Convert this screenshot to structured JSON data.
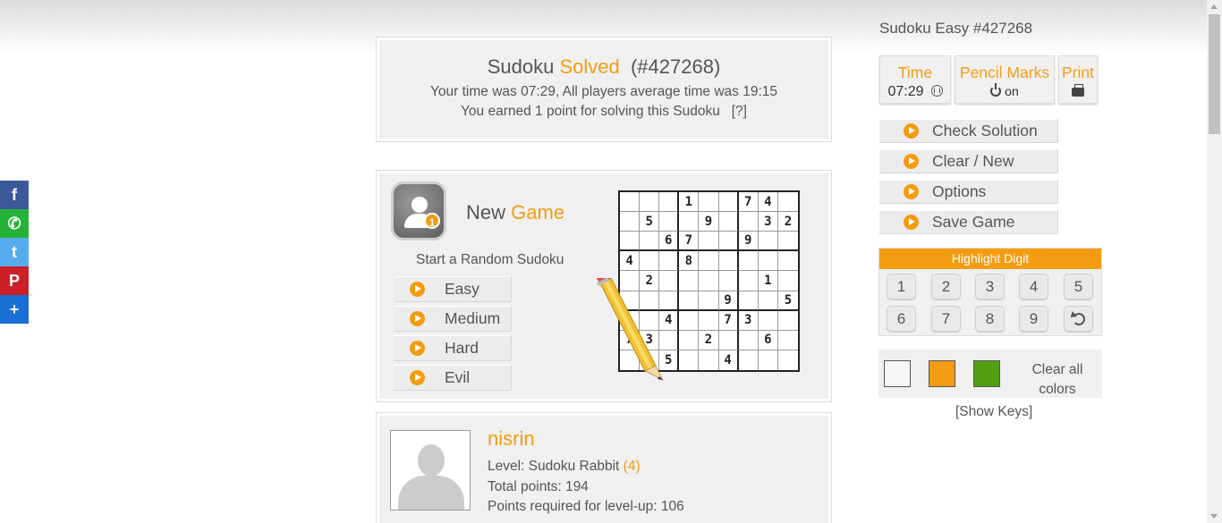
{
  "social": [
    {
      "name": "facebook",
      "glyph": "f",
      "color": "#3b5998"
    },
    {
      "name": "whatsapp",
      "glyph": "✆",
      "color": "#25b23a"
    },
    {
      "name": "twitter",
      "glyph": "t",
      "color": "#55acee"
    },
    {
      "name": "pinterest",
      "glyph": "P",
      "color": "#cb2027"
    },
    {
      "name": "share",
      "glyph": "+",
      "color": "#1a6fd4"
    }
  ],
  "solved": {
    "word1": "Sudoku",
    "word2": "Solved",
    "id": "(#427268)",
    "time_line": "Your time was 07:29, All players average time was 19:15",
    "points_line": "You earned 1 point for solving this Sudoku",
    "help": "[?]"
  },
  "newgame": {
    "badge": "1",
    "title_a": "New",
    "title_b": "Game",
    "subtitle": "Start a Random Sudoku",
    "levels": [
      "Easy",
      "Medium",
      "Hard",
      "Evil"
    ]
  },
  "puzzle": [
    [
      "",
      "",
      "",
      "1",
      "",
      "",
      "7",
      "4",
      ""
    ],
    [
      "",
      "5",
      "",
      "",
      "9",
      "",
      "",
      "3",
      "2"
    ],
    [
      "",
      "",
      "6",
      "7",
      "",
      "",
      "9",
      "",
      ""
    ],
    [
      "4",
      "",
      "",
      "8",
      "",
      "",
      "",
      "",
      ""
    ],
    [
      "",
      "2",
      "",
      "",
      "",
      "",
      "",
      "1",
      ""
    ],
    [
      "",
      "",
      "",
      "",
      "",
      "9",
      "",
      "",
      "5"
    ],
    [
      "",
      "",
      "4",
      "",
      "",
      "7",
      "3",
      "",
      ""
    ],
    [
      "7",
      "3",
      "",
      "",
      "2",
      "",
      "",
      "6",
      ""
    ],
    [
      "",
      "",
      "5",
      "",
      "",
      "4",
      "",
      "",
      ""
    ]
  ],
  "profile": {
    "name": "nisrin",
    "level_label": "Level: Sudoku Rabbit",
    "level_num": "(4)",
    "total": "Total points: 194",
    "required": "Points required for level-up: 106"
  },
  "sidebar": {
    "title": "Sudoku Easy #427268",
    "time_label": "Time",
    "time_value": "07:29",
    "pencil_label": "Pencil Marks",
    "pencil_value": "on",
    "print_label": "Print",
    "actions": [
      "Check Solution",
      "Clear / New",
      "Options",
      "Save Game"
    ],
    "highlight_title": "Highlight Digit",
    "digits": [
      "1",
      "2",
      "3",
      "4",
      "5",
      "6",
      "7",
      "8",
      "9"
    ],
    "clear_colors": "Clear all colors",
    "show_keys": "[Show Keys]"
  },
  "colors": {
    "accent": "#f39c12",
    "white_swatch": "#f7f7f7",
    "orange_swatch": "#f39c12",
    "green_swatch": "#52a012"
  }
}
